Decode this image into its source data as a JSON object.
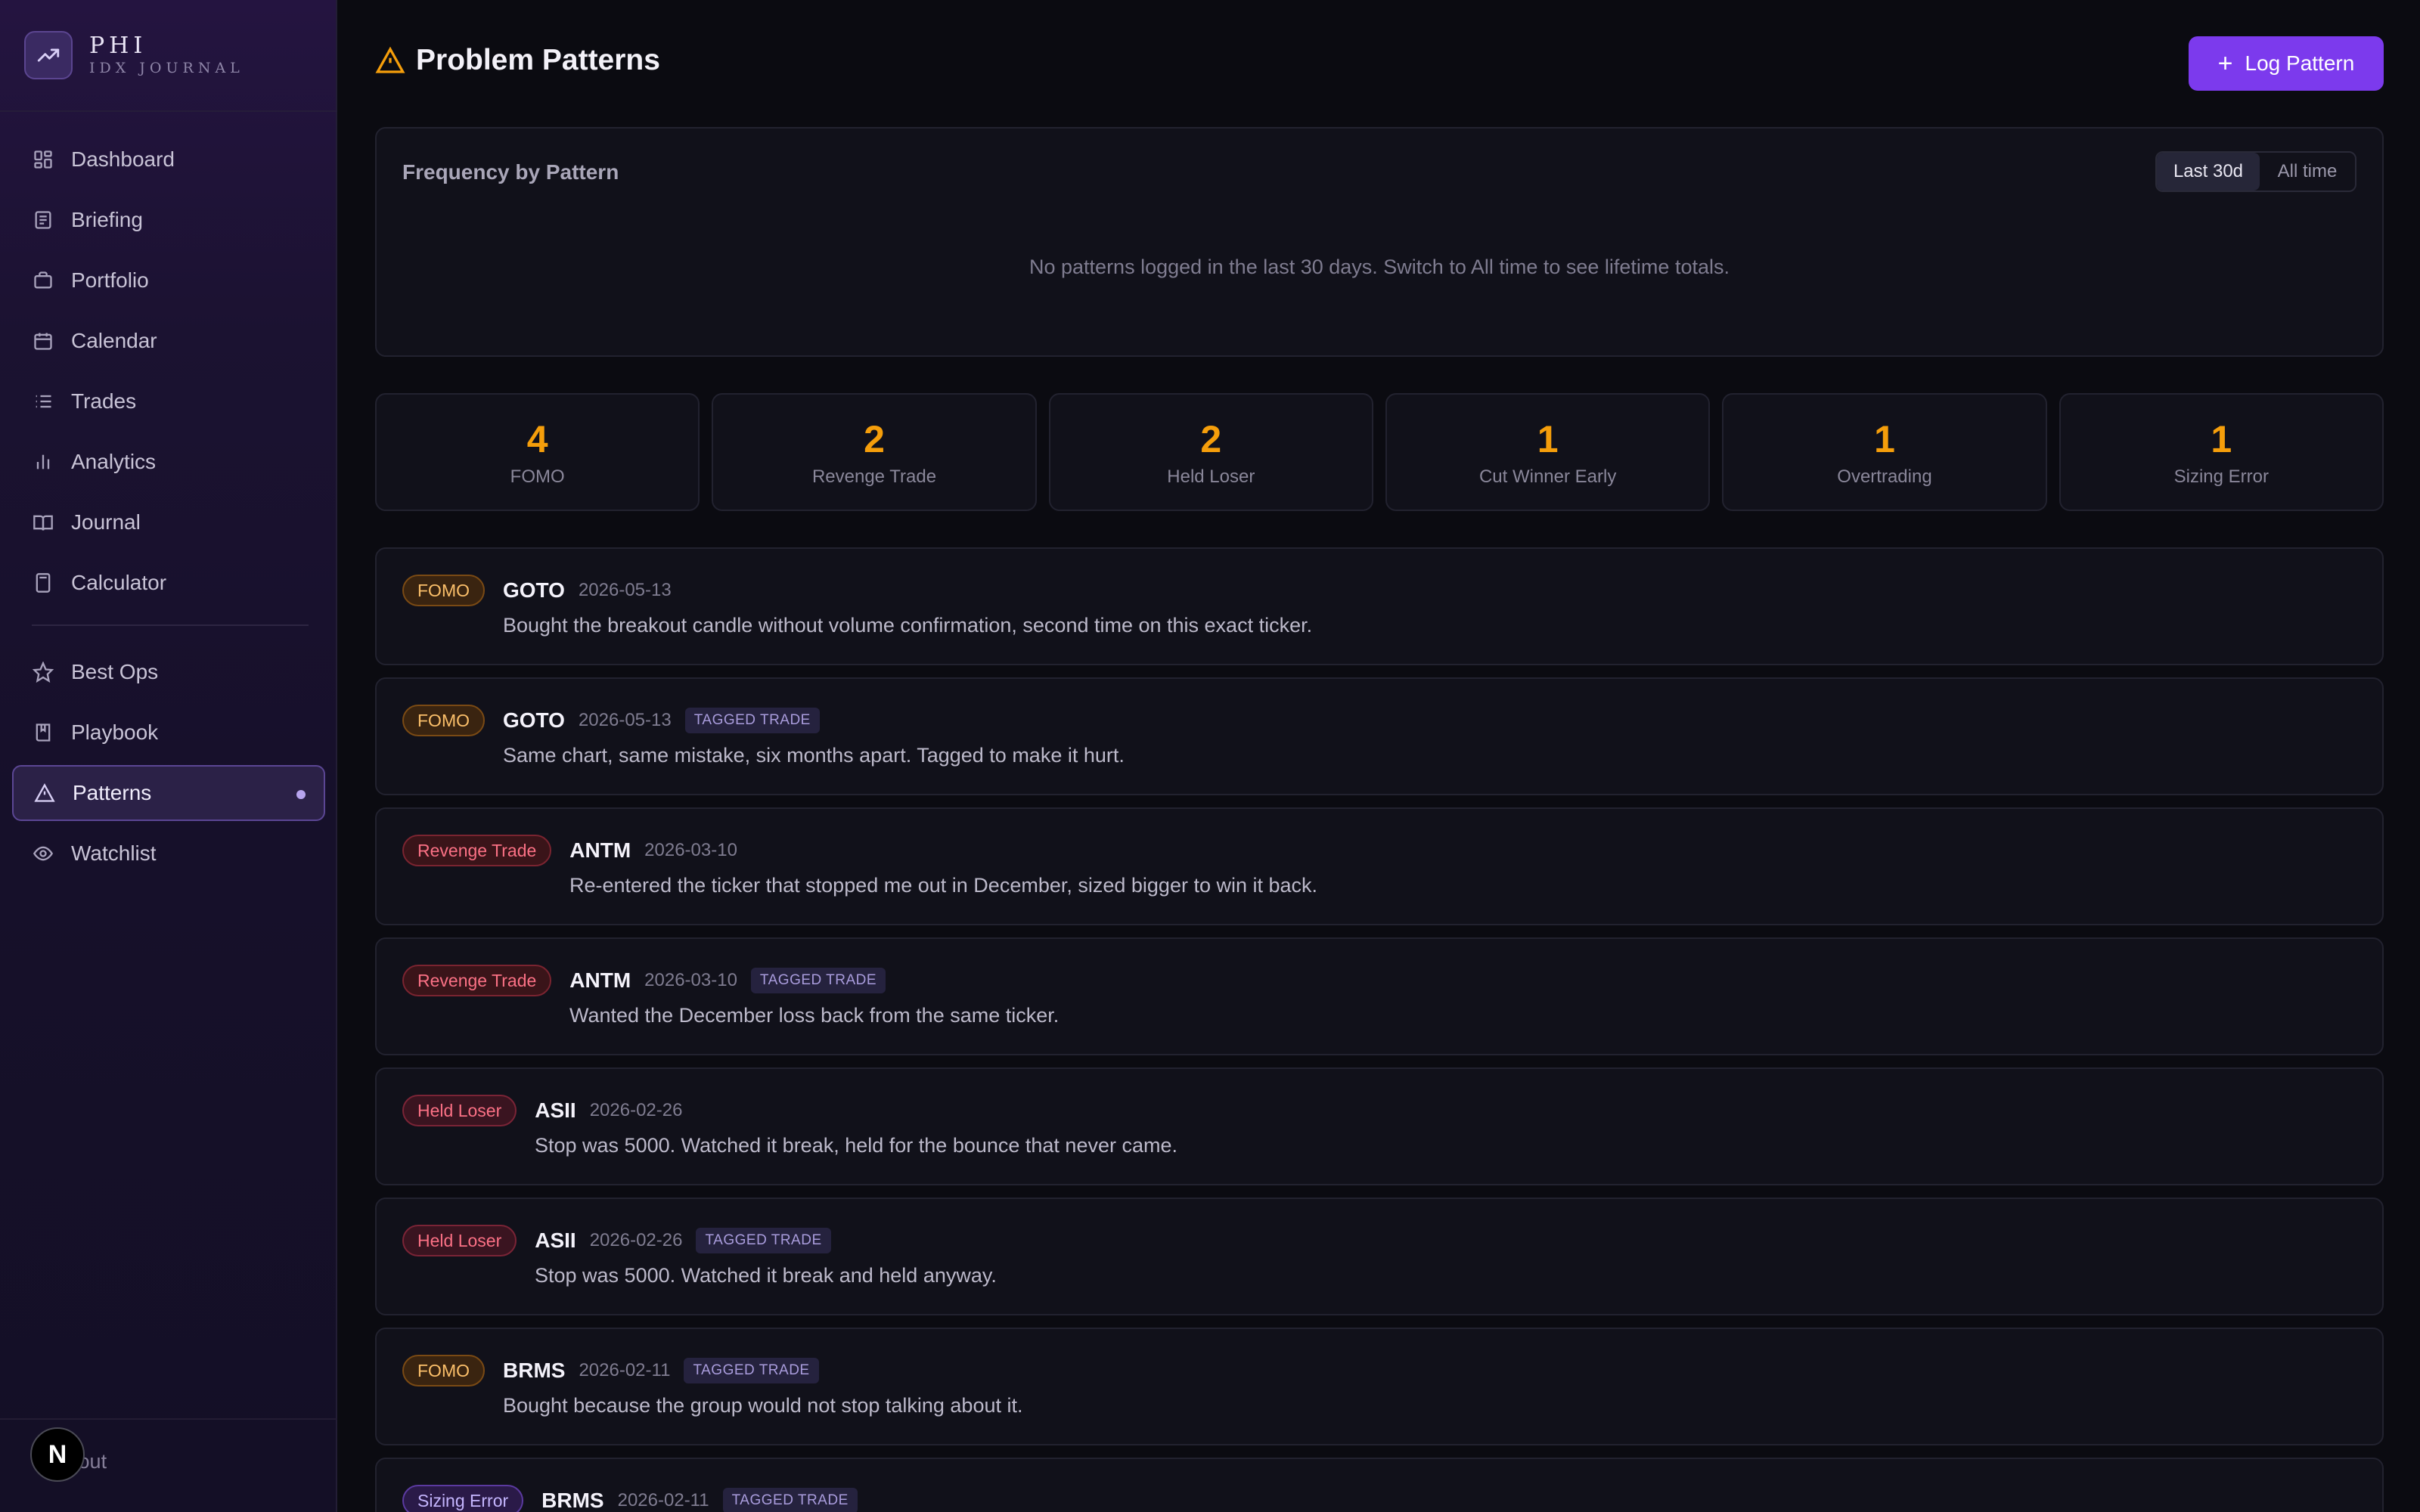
{
  "brand": {
    "name": "PHI",
    "subtitle": "IDX JOURNAL"
  },
  "nav": {
    "primary": [
      {
        "label": "Dashboard",
        "icon": "dashboard-icon"
      },
      {
        "label": "Briefing",
        "icon": "newspaper-icon"
      },
      {
        "label": "Portfolio",
        "icon": "briefcase-icon"
      },
      {
        "label": "Calendar",
        "icon": "calendar-icon"
      },
      {
        "label": "Trades",
        "icon": "list-icon"
      },
      {
        "label": "Analytics",
        "icon": "bar-chart-icon"
      },
      {
        "label": "Journal",
        "icon": "book-icon"
      },
      {
        "label": "Calculator",
        "icon": "calculator-icon"
      }
    ],
    "secondary": [
      {
        "label": "Best Ops",
        "icon": "star-icon"
      },
      {
        "label": "Playbook",
        "icon": "bookmark-book-icon"
      },
      {
        "label": "Patterns",
        "icon": "warning-icon",
        "active": true
      },
      {
        "label": "Watchlist",
        "icon": "eye-icon"
      }
    ],
    "signout_label": "Sign out"
  },
  "header": {
    "title": "Problem Patterns",
    "log_button": "Log Pattern"
  },
  "frequency": {
    "title": "Frequency by Pattern",
    "toggle": {
      "active": "Last 30d",
      "inactive": "All time"
    },
    "empty_message": "No patterns logged in the last 30 days. Switch to All time to see lifetime totals."
  },
  "stats": [
    {
      "count": "4",
      "label": "FOMO"
    },
    {
      "count": "2",
      "label": "Revenge Trade"
    },
    {
      "count": "2",
      "label": "Held Loser"
    },
    {
      "count": "1",
      "label": "Cut Winner Early"
    },
    {
      "count": "1",
      "label": "Overtrading"
    },
    {
      "count": "1",
      "label": "Sizing Error"
    }
  ],
  "entries": [
    {
      "pattern": "FOMO",
      "kind": "fomo",
      "ticker": "GOTO",
      "date": "2026-05-13",
      "tagged": "",
      "note": "Bought the breakout candle without volume confirmation, second time on this exact ticker."
    },
    {
      "pattern": "FOMO",
      "kind": "fomo",
      "ticker": "GOTO",
      "date": "2026-05-13",
      "tagged": "TAGGED TRADE",
      "note": "Same chart, same mistake, six months apart. Tagged to make it hurt."
    },
    {
      "pattern": "Revenge Trade",
      "kind": "revenge",
      "ticker": "ANTM",
      "date": "2026-03-10",
      "tagged": "",
      "note": "Re-entered the ticker that stopped me out in December, sized bigger to win it back."
    },
    {
      "pattern": "Revenge Trade",
      "kind": "revenge",
      "ticker": "ANTM",
      "date": "2026-03-10",
      "tagged": "TAGGED TRADE",
      "note": "Wanted the December loss back from the same ticker."
    },
    {
      "pattern": "Held Loser",
      "kind": "held",
      "ticker": "ASII",
      "date": "2026-02-26",
      "tagged": "",
      "note": "Stop was 5000. Watched it break, held for the bounce that never came."
    },
    {
      "pattern": "Held Loser",
      "kind": "held",
      "ticker": "ASII",
      "date": "2026-02-26",
      "tagged": "TAGGED TRADE",
      "note": "Stop was 5000. Watched it break and held anyway."
    },
    {
      "pattern": "FOMO",
      "kind": "fomo",
      "ticker": "BRMS",
      "date": "2026-02-11",
      "tagged": "TAGGED TRADE",
      "note": "Bought because the group would not stop talking about it."
    },
    {
      "pattern": "Sizing Error",
      "kind": "sizing",
      "ticker": "BRMS",
      "date": "2026-02-11",
      "tagged": "TAGGED TRADE",
      "note": ""
    }
  ],
  "colors": {
    "accent": "#7c3aed",
    "stat_number": "#f59e0b",
    "background": "#0b0b11"
  },
  "overlay_badge": "N"
}
